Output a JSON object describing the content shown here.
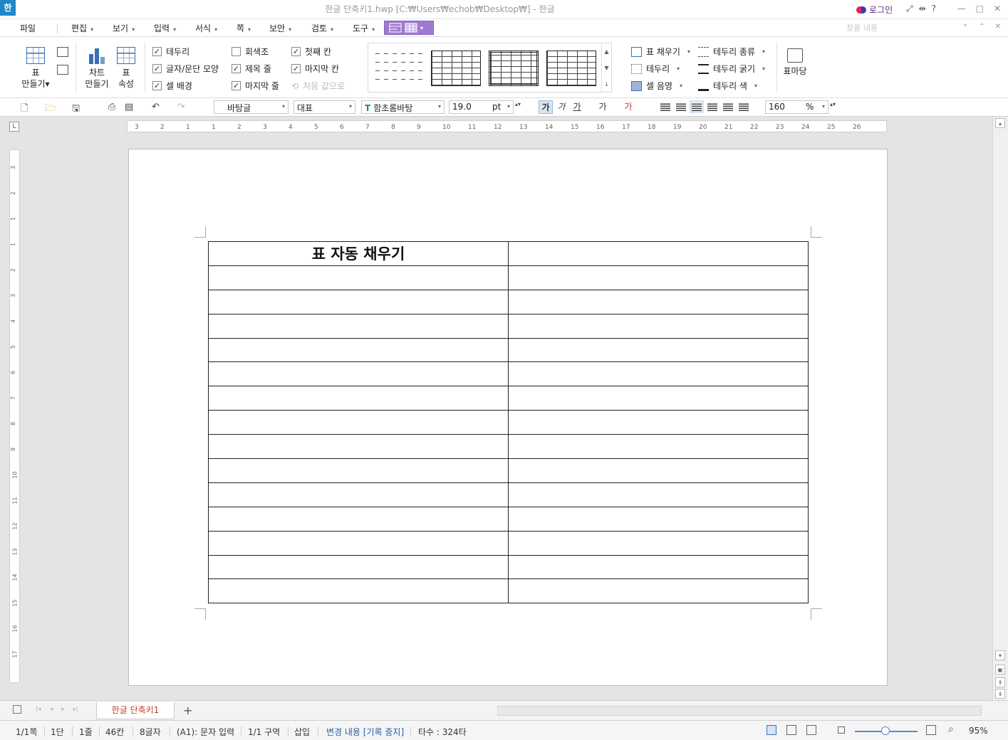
{
  "app": {
    "logo": "한",
    "title": "한글 단축키1.hwp [C:₩Users₩echob₩Desktop₩] - 한글",
    "login_label": "로그인",
    "title_icons": [
      "⤢",
      "⇹",
      "?"
    ],
    "window_buttons": [
      "—",
      "□",
      "✕"
    ]
  },
  "menu": {
    "items": [
      {
        "label": "파일",
        "caret": ""
      },
      {
        "label": "편집",
        "caret": "▾"
      },
      {
        "label": "보기",
        "caret": "▾"
      },
      {
        "label": "입력",
        "caret": "▾"
      },
      {
        "label": "서식",
        "caret": "▾"
      },
      {
        "label": "쪽",
        "caret": "▾"
      },
      {
        "label": "보안",
        "caret": "▾"
      },
      {
        "label": "검토",
        "caret": "▾"
      },
      {
        "label": "도구",
        "caret": "▾"
      }
    ],
    "active_caret": "▾",
    "search_placeholder": "찾을 내용",
    "search_caret": "▾",
    "right_icons": [
      "⌃",
      "✕"
    ]
  },
  "ribbon": {
    "make_table": {
      "line1": "표",
      "line2": "만들기▾"
    },
    "make_chart": {
      "line1": "차트",
      "line2": "만들기"
    },
    "table_props": {
      "line1": "표",
      "line2": "속성"
    },
    "checkboxes": [
      {
        "label": "테두리",
        "checked": "✓"
      },
      {
        "label": "글자/문단 모양",
        "checked": "✓"
      },
      {
        "label": "셀 배경",
        "checked": "✓"
      },
      {
        "label": "회색조",
        "checked": ""
      },
      {
        "label": "제목 줄",
        "checked": "✓"
      },
      {
        "label": "마지막 줄",
        "checked": "✓"
      },
      {
        "label": "첫째 칸",
        "checked": "✓"
      },
      {
        "label": "마지막 칸",
        "checked": "✓"
      },
      {
        "label": "처음 값으로",
        "checked": ""
      }
    ],
    "gallery_scroll": [
      "▲",
      "▼",
      "↓"
    ],
    "cell_tools": [
      {
        "label": "표 채우기",
        "caret": "▾"
      },
      {
        "label": "테두리",
        "caret": "▾"
      },
      {
        "label": "셀 음영",
        "caret": "▾"
      },
      {
        "label": "테두리 종류",
        "caret": "▾"
      },
      {
        "label": "테두리 굵기",
        "caret": "▾"
      },
      {
        "label": "테두리 색",
        "caret": "▾"
      }
    ],
    "table_wizard": "표마당"
  },
  "toolbar": {
    "style": "바탕글",
    "lang": "대표",
    "font_prefix": "T",
    "font": "함초롬바탕",
    "size": "19.0",
    "size_unit": "pt",
    "spin": "▴▾",
    "caret": "▾",
    "format_buttons": [
      "가",
      "가",
      "가",
      "가",
      "가"
    ],
    "zoom_value": "160",
    "zoom_unit": "%"
  },
  "ruler": {
    "h_ticks": [
      "3",
      "2",
      "1",
      "1",
      "2",
      "3",
      "4",
      "5",
      "6",
      "7",
      "8",
      "9",
      "10",
      "11",
      "12",
      "13",
      "14",
      "15",
      "16",
      "17",
      "18",
      "19",
      "20",
      "21",
      "22",
      "23",
      "24",
      "25",
      "26"
    ],
    "v_ticks": [
      "3",
      "2",
      "1",
      "1",
      "2",
      "3",
      "4",
      "5",
      "6",
      "7",
      "8",
      "9",
      "10",
      "11",
      "12",
      "13",
      "14",
      "15",
      "16",
      "17"
    ],
    "corner": "L"
  },
  "document": {
    "header_cell": "표 자동 채우기",
    "rows": 15,
    "cols": 2
  },
  "tabs": {
    "nav": [
      "|◂",
      "◂",
      "▸",
      "▸|"
    ],
    "active": "한글 단축키1",
    "add": "+"
  },
  "status": {
    "page": "1/1쪽",
    "column": "1단",
    "line": "1줄",
    "char_pos": "46칸",
    "char_count": "8글자",
    "cell": "(A1): 문자 입력",
    "section": "1/1 구역",
    "mode": "삽입",
    "track": "변경 내용 [기록 중지]",
    "typing": "타수 : 324타",
    "zoom": "95%"
  },
  "colors": {
    "accent_purple": "#a07ad0",
    "track_blue": "#1f5fa8",
    "tab_red": "#c0392b"
  }
}
